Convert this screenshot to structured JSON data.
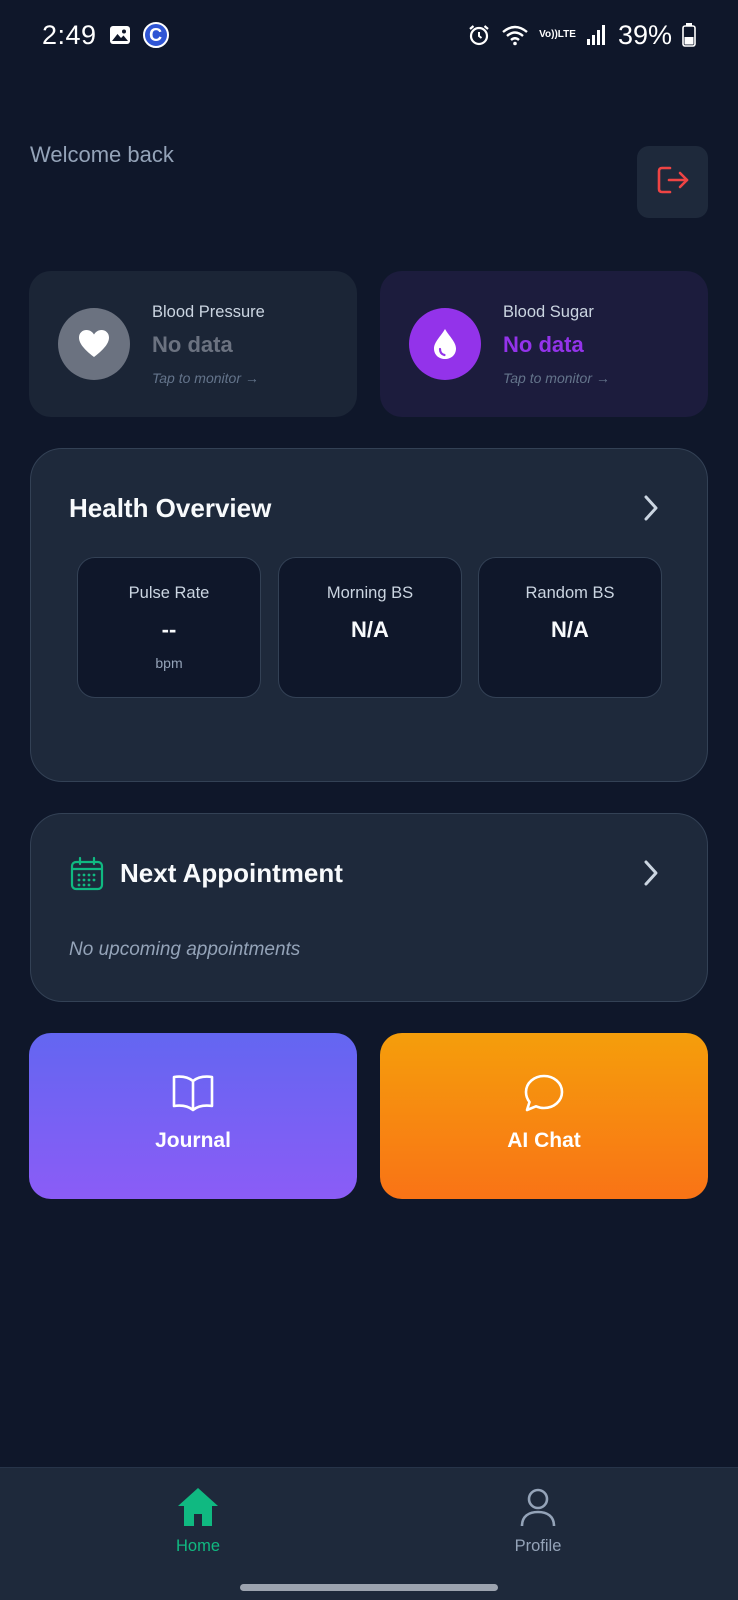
{
  "status_bar": {
    "time": "2:49",
    "c_badge": "C",
    "lte_top": "Vo))",
    "lte_bottom": "LTE",
    "battery": "39%"
  },
  "header": {
    "welcome": "Welcome back",
    "logout_icon": "logout-icon"
  },
  "metrics": {
    "blood_pressure": {
      "label": "Blood Pressure",
      "value": "No data",
      "hint": "Tap to monitor →",
      "icon": "heart-icon",
      "color": "#6b7280"
    },
    "blood_sugar": {
      "label": "Blood Sugar",
      "value": "No data",
      "hint": "Tap to monitor →",
      "icon": "drop-icon",
      "color": "#9333ea"
    }
  },
  "overview": {
    "title": "Health Overview",
    "stats": [
      {
        "label": "Pulse Rate",
        "value": "--",
        "unit": "bpm"
      },
      {
        "label": "Morning BS",
        "value": "N/A"
      },
      {
        "label": "Random BS",
        "value": "N/A"
      }
    ]
  },
  "appointment": {
    "title": "Next Appointment",
    "empty": "No upcoming appointments",
    "icon": "calendar-icon",
    "accent": "#10b981"
  },
  "actions": {
    "journal": {
      "label": "Journal",
      "icon": "book-icon"
    },
    "ai_chat": {
      "label": "AI Chat",
      "icon": "chat-bubble-icon"
    }
  },
  "nav": {
    "home": {
      "label": "Home",
      "icon": "home-icon",
      "active": true
    },
    "profile": {
      "label": "Profile",
      "icon": "user-icon",
      "active": false
    }
  }
}
